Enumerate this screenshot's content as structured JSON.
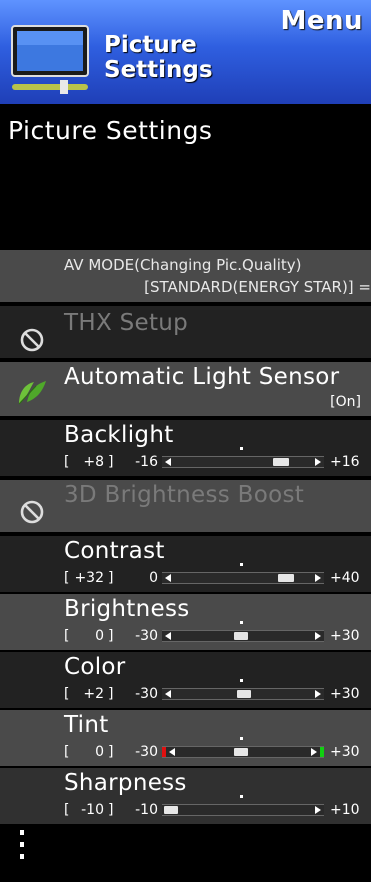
{
  "header": {
    "menu_label": "Menu",
    "title_line1": "Picture",
    "title_line2": "Settings",
    "colors": {
      "gradient_top": "#5f93ff",
      "gradient_bottom": "#1f3fb7"
    }
  },
  "section_title": "Picture Settings",
  "av_mode": {
    "label": "AV MODE(Changing Pic.Quality)",
    "value": "[STANDARD(ENERGY STAR)] ="
  },
  "items": {
    "thx": {
      "label": "THX Setup",
      "icon": "prohibited-icon",
      "enabled": false
    },
    "light_sensor": {
      "label": "Automatic Light Sensor",
      "value": "[On]",
      "icon": "leaf-icon"
    },
    "backlight": {
      "label": "Backlight",
      "value": "+8",
      "min": "-16",
      "max": "+16",
      "level": 0.75
    },
    "brightness_boost": {
      "label": "3D Brightness Boost",
      "icon": "prohibited-icon",
      "enabled": false
    },
    "contrast": {
      "label": "Contrast",
      "value": "+32",
      "min": "0",
      "max": "+40",
      "level": 0.8
    },
    "brightness": {
      "label": "Brightness",
      "value": "0",
      "min": "-30",
      "max": "+30",
      "level": 0.5
    },
    "color": {
      "label": "Color",
      "value": "+2",
      "min": "-30",
      "max": "+30",
      "level": 0.53
    },
    "tint": {
      "label": "Tint",
      "value": "0",
      "min": "-30",
      "max": "+30",
      "level": 0.5,
      "left_color": "#e01010",
      "right_color": "#10d010"
    },
    "sharpness": {
      "label": "Sharpness",
      "value": "-10",
      "min": "-10",
      "max": "+10",
      "level": 0.0
    }
  },
  "more_indicator": "more-options-icon"
}
